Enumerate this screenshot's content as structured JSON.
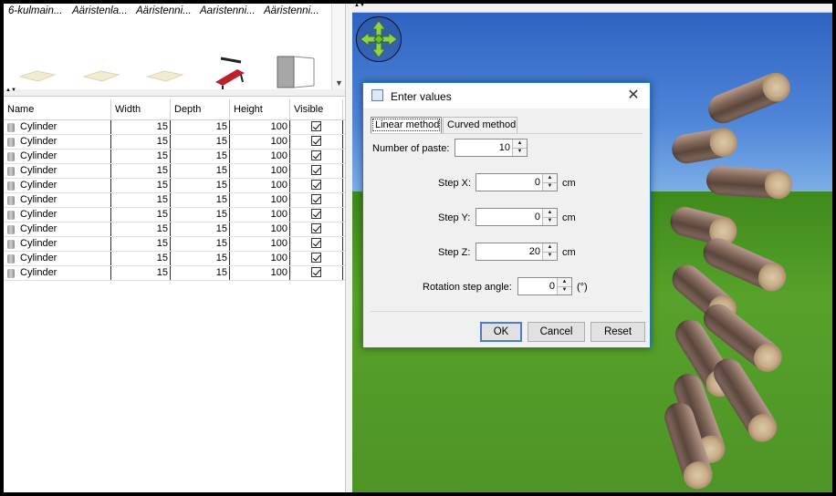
{
  "catalog": {
    "names": [
      "6-kulmain...",
      "Ääristenla...",
      "Ääristenni...",
      "Aaristenni...",
      "Ääristenni..."
    ],
    "icons": [
      "floor-tile-icon",
      "floor-tile-icon",
      "floor-tile-icon",
      "bench-press-icon",
      "cage-icon"
    ]
  },
  "table": {
    "headers": {
      "name": "Name",
      "width": "Width",
      "depth": "Depth",
      "height": "Height",
      "visible": "Visible"
    },
    "rows": [
      {
        "name": "Cylinder",
        "width": "15",
        "depth": "15",
        "height": "100",
        "visible": true
      },
      {
        "name": "Cylinder",
        "width": "15",
        "depth": "15",
        "height": "100",
        "visible": true
      },
      {
        "name": "Cylinder",
        "width": "15",
        "depth": "15",
        "height": "100",
        "visible": true
      },
      {
        "name": "Cylinder",
        "width": "15",
        "depth": "15",
        "height": "100",
        "visible": true
      },
      {
        "name": "Cylinder",
        "width": "15",
        "depth": "15",
        "height": "100",
        "visible": true
      },
      {
        "name": "Cylinder",
        "width": "15",
        "depth": "15",
        "height": "100",
        "visible": true
      },
      {
        "name": "Cylinder",
        "width": "15",
        "depth": "15",
        "height": "100",
        "visible": true
      },
      {
        "name": "Cylinder",
        "width": "15",
        "depth": "15",
        "height": "100",
        "visible": true
      },
      {
        "name": "Cylinder",
        "width": "15",
        "depth": "15",
        "height": "100",
        "visible": true
      },
      {
        "name": "Cylinder",
        "width": "15",
        "depth": "15",
        "height": "100",
        "visible": true
      },
      {
        "name": "Cylinder",
        "width": "15",
        "depth": "15",
        "height": "100",
        "visible": true
      }
    ]
  },
  "dialog": {
    "title": "Enter values",
    "tabs": [
      "Linear method",
      "Curved method"
    ],
    "active_tab": "Linear method",
    "paste_label": "Number of paste:",
    "paste_value": "10",
    "step_x_label": "Step X:",
    "step_x_value": "0",
    "step_x_unit": "cm",
    "step_y_label": "Step Y:",
    "step_y_value": "0",
    "step_y_unit": "cm",
    "step_z_label": "Step Z:",
    "step_z_value": "20",
    "step_z_unit": "cm",
    "rotation_label": "Rotation step angle:",
    "rotation_value": "0",
    "rotation_unit": "(°)",
    "ok_label": "OK",
    "cancel_label": "Cancel",
    "reset_label": "Reset"
  },
  "colors": {
    "sky": "#2f63c2",
    "grass": "#56a22a",
    "accent": "#1979ca"
  }
}
